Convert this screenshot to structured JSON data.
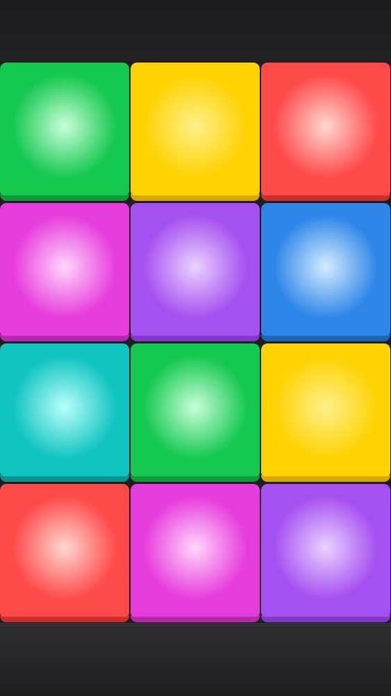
{
  "pads": [
    {
      "color": "green",
      "base": "#14c850",
      "glow": "#c8ffd8",
      "lip": "#0f9a3c"
    },
    {
      "color": "yellow",
      "base": "#ffd200",
      "glow": "#fff08a",
      "lip": "#d9a800"
    },
    {
      "color": "red",
      "base": "#ff4a4a",
      "glow": "#ffd8d0",
      "lip": "#cc2e2e"
    },
    {
      "color": "magenta",
      "base": "#e63cdc",
      "glow": "#ffd6fb",
      "lip": "#b528ae"
    },
    {
      "color": "purple",
      "base": "#a550f0",
      "glow": "#ead2ff",
      "lip": "#8238c8"
    },
    {
      "color": "blue",
      "base": "#2e86e8",
      "glow": "#d4ecff",
      "lip": "#1c64b8"
    },
    {
      "color": "cyan",
      "base": "#10c4c0",
      "glow": "#b8fffa",
      "lip": "#0a9490"
    },
    {
      "color": "green",
      "base": "#14c850",
      "glow": "#c8ffd8",
      "lip": "#0f9a3c"
    },
    {
      "color": "yellow",
      "base": "#ffd200",
      "glow": "#fff08a",
      "lip": "#d9a800"
    },
    {
      "color": "red",
      "base": "#ff4a4a",
      "glow": "#ffd8d0",
      "lip": "#cc2e2e"
    },
    {
      "color": "magenta",
      "base": "#e63cdc",
      "glow": "#ffd6fb",
      "lip": "#b528ae"
    },
    {
      "color": "purple",
      "base": "#a550f0",
      "glow": "#ead2ff",
      "lip": "#8238c8"
    }
  ]
}
